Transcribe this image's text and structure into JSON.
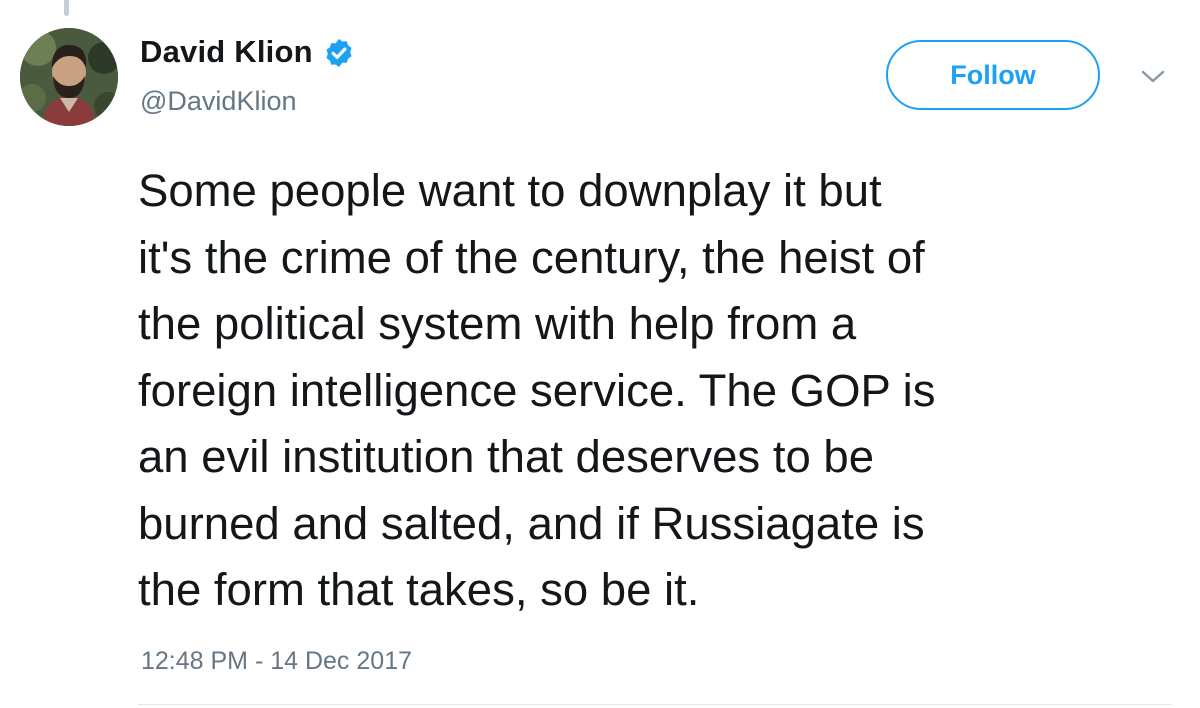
{
  "author": {
    "display_name": "David Klion",
    "handle": "@DavidKlion",
    "verified": true
  },
  "actions": {
    "follow_label": "Follow",
    "menu_icon": "chevron-down-icon"
  },
  "tweet": {
    "text": "Some people want to downplay it but\nit's the crime of the century, the heist of\nthe political system with help from a\nforeign intelligence service. The GOP is\nan evil institution that deserves to be\nburned and salted, and if Russiagate is\nthe form that takes, so be it.",
    "timestamp": "12:48 PM - 14 Dec 2017"
  },
  "colors": {
    "accent": "#1da1f2",
    "text": "#14171a",
    "secondary_text": "#657786",
    "divider": "#e1e8ed"
  },
  "icons": {
    "verified": "verified-badge-icon",
    "avatar": "profile-photo"
  }
}
